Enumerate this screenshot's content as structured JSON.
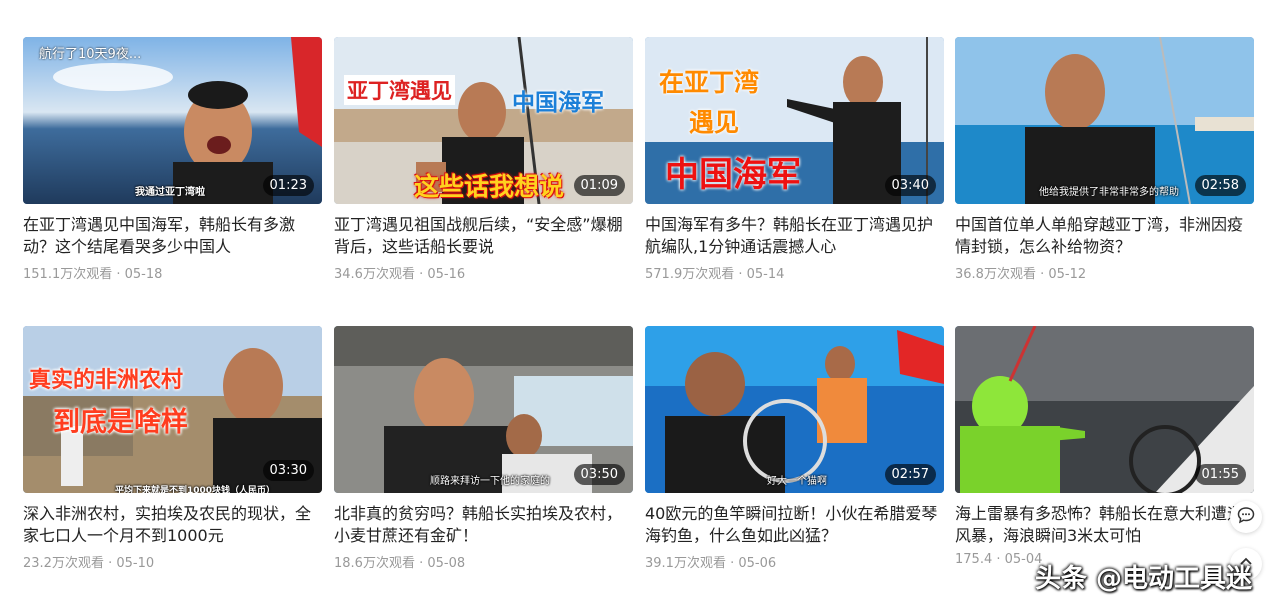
{
  "videos": [
    {
      "title": "在亚丁湾遇见中国海军，韩船长有多激动？这个结尾看哭多少中国人",
      "views": "151.1万次观看",
      "date": "05-18",
      "duration": "01:23",
      "overlay_texts": [
        "航行了10天9夜...",
        "我通过亚丁湾啦"
      ]
    },
    {
      "title": "亚丁湾遇见祖国战舰后续，“安全感”爆棚背后，这些话船长要说",
      "views": "34.6万次观看",
      "date": "05-16",
      "duration": "01:09",
      "overlay_texts": [
        "亚丁湾遇见",
        "中国海军",
        "这些话我想说"
      ]
    },
    {
      "title": "中国海军有多牛？韩船长在亚丁湾遇见护航编队,1分钟通话震撼人心",
      "views": "571.9万次观看",
      "date": "05-14",
      "duration": "03:40",
      "overlay_texts": [
        "在亚丁湾",
        "遇见",
        "中国海军"
      ]
    },
    {
      "title": "中国首位单人单船穿越亚丁湾，非洲因疫情封锁，怎么补给物资？",
      "views": "36.8万次观看",
      "date": "05-12",
      "duration": "02:58",
      "overlay_texts": [
        "他给我提供了非常非常多的帮助"
      ]
    },
    {
      "title": "深入非洲农村，实拍埃及农民的现状，全家七口人一个月不到1000元",
      "views": "23.2万次观看",
      "date": "05-10",
      "duration": "03:30",
      "overlay_texts": [
        "真实的非洲农村",
        "到底是啥样",
        "平均下来就是不到1000块钱（人民币）"
      ]
    },
    {
      "title": "北非真的贫穷吗？韩船长实拍埃及农村，小麦甘蔗还有金矿！",
      "views": "18.6万次观看",
      "date": "05-08",
      "duration": "03:50",
      "overlay_texts": [
        "顺路来拜访一下他的家庭的"
      ]
    },
    {
      "title": "40欧元的鱼竿瞬间拉断！小伙在希腊爱琴海钓鱼，什么鱼如此凶猛？",
      "views": "39.1万次观看",
      "date": "05-06",
      "duration": "02:57",
      "overlay_texts": [
        "好大一个猫啊"
      ]
    },
    {
      "title": "海上雷暴有多恐怖？韩船长在意大利遭遇风暴，海浪瞬间3米太可怕",
      "views": "175.4",
      "date": "05-04",
      "duration": "01:55",
      "overlay_texts": []
    }
  ],
  "watermark": "头条 @电动工具迷",
  "separator": " · ",
  "icons": {
    "chat": "chat-bubble-icon",
    "top": "back-to-top-icon"
  }
}
